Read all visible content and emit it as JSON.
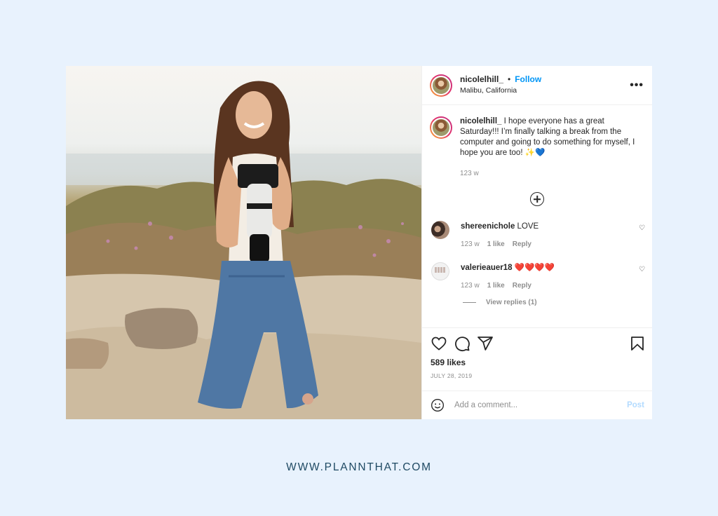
{
  "post": {
    "username": "nicolelhill_",
    "separator": "•",
    "follow_label": "Follow",
    "location": "Malibu, California",
    "more_icon": "more-horizontal-icon"
  },
  "caption": {
    "username": "nicolelhill_",
    "text": " I hope everyone has a great Saturday!!! I’m finally talking a break from the computer and going to do something for myself, I hope you are too! ✨💙",
    "time": "123 w"
  },
  "comments": [
    {
      "username": "shereenichole",
      "text": " LOVE",
      "time": "123 w",
      "likes": "1 like",
      "reply_label": "Reply"
    },
    {
      "username": "valerieauer18",
      "text": " ❤️❤️❤️❤️",
      "time": "123 w",
      "likes": "1 like",
      "reply_label": "Reply"
    }
  ],
  "view_replies": "View replies (1)",
  "actions": {
    "likes": "589 likes",
    "date": "JULY 28, 2019"
  },
  "add_comment": {
    "placeholder": "Add a comment...",
    "post_label": "Post"
  },
  "footer": {
    "url": "WWW.PLANNTHAT.COM"
  },
  "colors": {
    "background": "#e8f2fd",
    "follow": "#0095f6",
    "post_disabled": "#b3dbff",
    "footer_text": "#1f4a63"
  }
}
